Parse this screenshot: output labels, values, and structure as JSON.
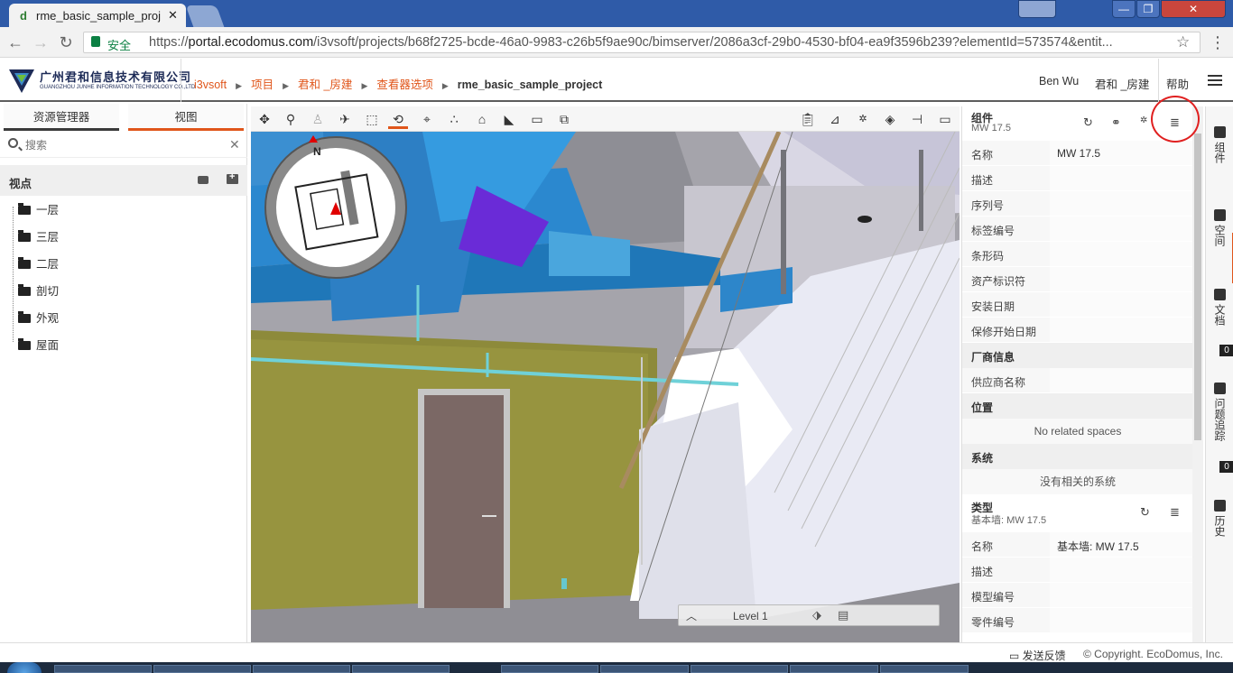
{
  "browser": {
    "tab_title": "rme_basic_sample_proj",
    "tab_close": "✕",
    "security_label": "安全",
    "url_scheme": "https://",
    "url_host": "portal.ecodomus.com",
    "url_path": "/i3vsoft/projects/b68f2725-bcde-46a0-9983-c26b5f9ae90c/bimserver/2086a3cf-29b0-4530-bf04-ea9f3596b239?elementId=573574&entit...",
    "min": "—",
    "max": "❐",
    "close": "✕"
  },
  "header": {
    "logo_cn": "广州君和信息技术有限公司",
    "logo_en": "GUANGZHOU JUNHE INFORMATION TECHNOLOGY CO.,LTD",
    "breadcrumb": [
      "i3vsoft",
      "项目",
      "君和 _房建",
      "查看器选项"
    ],
    "breadcrumb_current": "rme_basic_sample_project",
    "user": "Ben Wu",
    "org": "君和 _房建",
    "help": "帮助"
  },
  "left": {
    "tabs": [
      "资源管理器",
      "视图"
    ],
    "active_tab": 1,
    "search_placeholder": "搜索",
    "clear": "✕",
    "viewpoints_title": "视点",
    "tree": [
      "一层",
      "三层",
      "二层",
      "剖切",
      "外观",
      "屋面"
    ]
  },
  "viewer": {
    "compass_n": "N",
    "level": "Level 1"
  },
  "properties": {
    "component": {
      "title": "组件",
      "subtitle": "MW 17.5"
    },
    "rows1": [
      {
        "k": "名称",
        "v": "MW 17.5"
      },
      {
        "k": "描述",
        "v": ""
      },
      {
        "k": "序列号",
        "v": ""
      },
      {
        "k": "标签编号",
        "v": ""
      },
      {
        "k": "条形码",
        "v": ""
      },
      {
        "k": "资产标识符",
        "v": ""
      },
      {
        "k": "安装日期",
        "v": ""
      },
      {
        "k": "保修开始日期",
        "v": ""
      }
    ],
    "manufacturer": {
      "title": "厂商信息",
      "rows": [
        {
          "k": "供应商名称",
          "v": ""
        }
      ]
    },
    "location": {
      "title": "位置",
      "empty": "No related spaces"
    },
    "system": {
      "title": "系统",
      "empty": "没有相关的系统"
    },
    "type": {
      "title": "类型",
      "subtitle": "基本墙: MW 17.5"
    },
    "rows2": [
      {
        "k": "名称",
        "v": "基本墙: MW 17.5"
      },
      {
        "k": "描述",
        "v": ""
      },
      {
        "k": "模型编号",
        "v": ""
      },
      {
        "k": "零件编号",
        "v": ""
      }
    ]
  },
  "rail": {
    "items": [
      "组件",
      "空间",
      "文档",
      "问题追踪",
      "历史"
    ],
    "badges": [
      "0",
      "0"
    ]
  },
  "footer": {
    "feedback": "发送反馈",
    "copyright": "© Copyright. EcoDomus, Inc."
  },
  "colors": {
    "accent": "#e0561b",
    "header_blue": "#2f5ba8",
    "highlight": "#e02020"
  }
}
